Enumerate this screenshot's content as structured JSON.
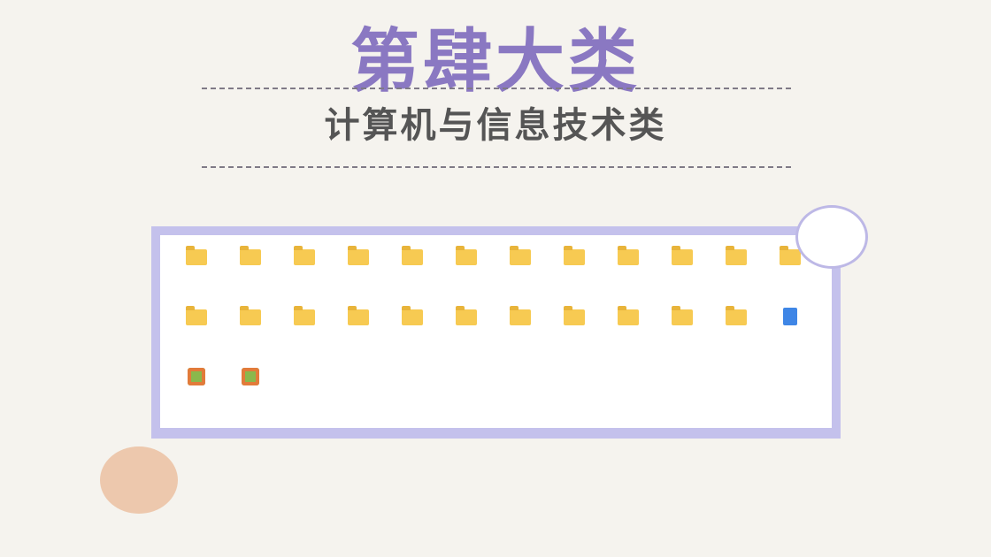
{
  "title": "第肆大类",
  "subtitle": "计算机与信息技术类",
  "items": [
    {
      "type": "folder",
      "label": ""
    },
    {
      "type": "folder",
      "label": ""
    },
    {
      "type": "folder",
      "label": ""
    },
    {
      "type": "folder",
      "label": ""
    },
    {
      "type": "folder",
      "label": ""
    },
    {
      "type": "folder",
      "label": ""
    },
    {
      "type": "folder",
      "label": ""
    },
    {
      "type": "folder",
      "label": ""
    },
    {
      "type": "folder",
      "label": ""
    },
    {
      "type": "folder",
      "label": ""
    },
    {
      "type": "folder",
      "label": ""
    },
    {
      "type": "folder",
      "label": ""
    },
    {
      "type": "folder",
      "label": ""
    },
    {
      "type": "folder",
      "label": ""
    },
    {
      "type": "folder",
      "label": ""
    },
    {
      "type": "folder",
      "label": ""
    },
    {
      "type": "folder",
      "label": ""
    },
    {
      "type": "folder",
      "label": ""
    },
    {
      "type": "folder",
      "label": ""
    },
    {
      "type": "folder",
      "label": ""
    },
    {
      "type": "folder",
      "label": ""
    },
    {
      "type": "folder",
      "label": ""
    },
    {
      "type": "folder",
      "label": ""
    },
    {
      "type": "doc",
      "label": ""
    },
    {
      "type": "app",
      "label": ""
    },
    {
      "type": "app",
      "label": ""
    }
  ]
}
